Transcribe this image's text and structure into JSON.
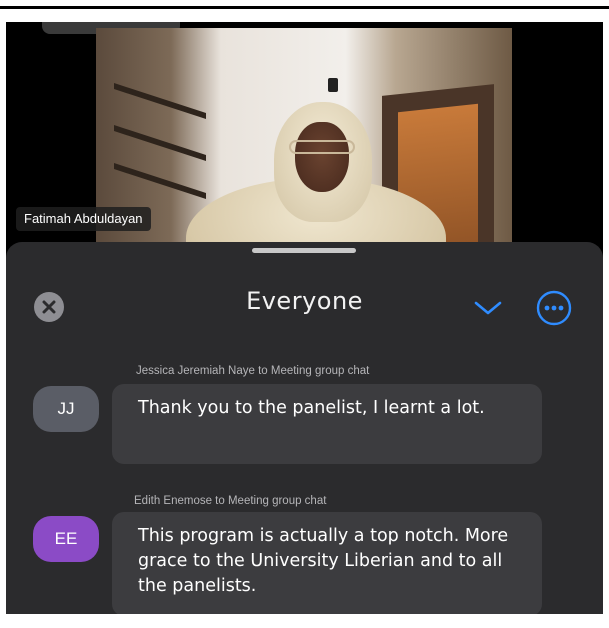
{
  "video": {
    "participant_name": "Fatimah Abduldayan"
  },
  "chat": {
    "title": "Everyone",
    "close_icon": "close-circle-icon",
    "chevron_icon": "chevron-down-icon",
    "more_icon": "more-options-icon",
    "accent_color": "#2f8cff",
    "messages": [
      {
        "sender_line": "Jessica Jeremiah Naye to Meeting group chat",
        "initials": "JJ",
        "avatar_color": "#5a5d66",
        "text": "Thank you to the panelist, I learnt a lot."
      },
      {
        "sender_line": "Edith Enemose to Meeting group chat",
        "initials": "EE",
        "avatar_color": "#8b4bc6",
        "text": "This program is actually a top notch. More grace to the University Liberian and to all the panelists."
      }
    ]
  }
}
